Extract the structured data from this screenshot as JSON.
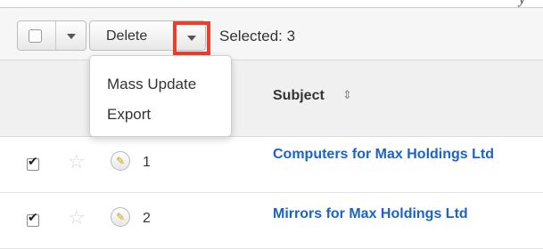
{
  "corner_glyph": "y",
  "toolbar": {
    "delete_label": "Delete",
    "selected_label": "Selected: 3"
  },
  "actions_menu": {
    "items": [
      {
        "label": "Mass Update"
      },
      {
        "label": "Export"
      }
    ]
  },
  "table": {
    "columns": [
      {
        "label": "Subject",
        "sortable": true
      }
    ],
    "rows": [
      {
        "checked": true,
        "favorite": false,
        "number": "1",
        "subject": "Computers for Max Holdings Ltd"
      },
      {
        "checked": true,
        "favorite": false,
        "number": "2",
        "subject": "Mirrors for Max Holdings Ltd"
      }
    ]
  },
  "colors": {
    "link": "#1a64c8",
    "highlight": "#e8402e"
  }
}
